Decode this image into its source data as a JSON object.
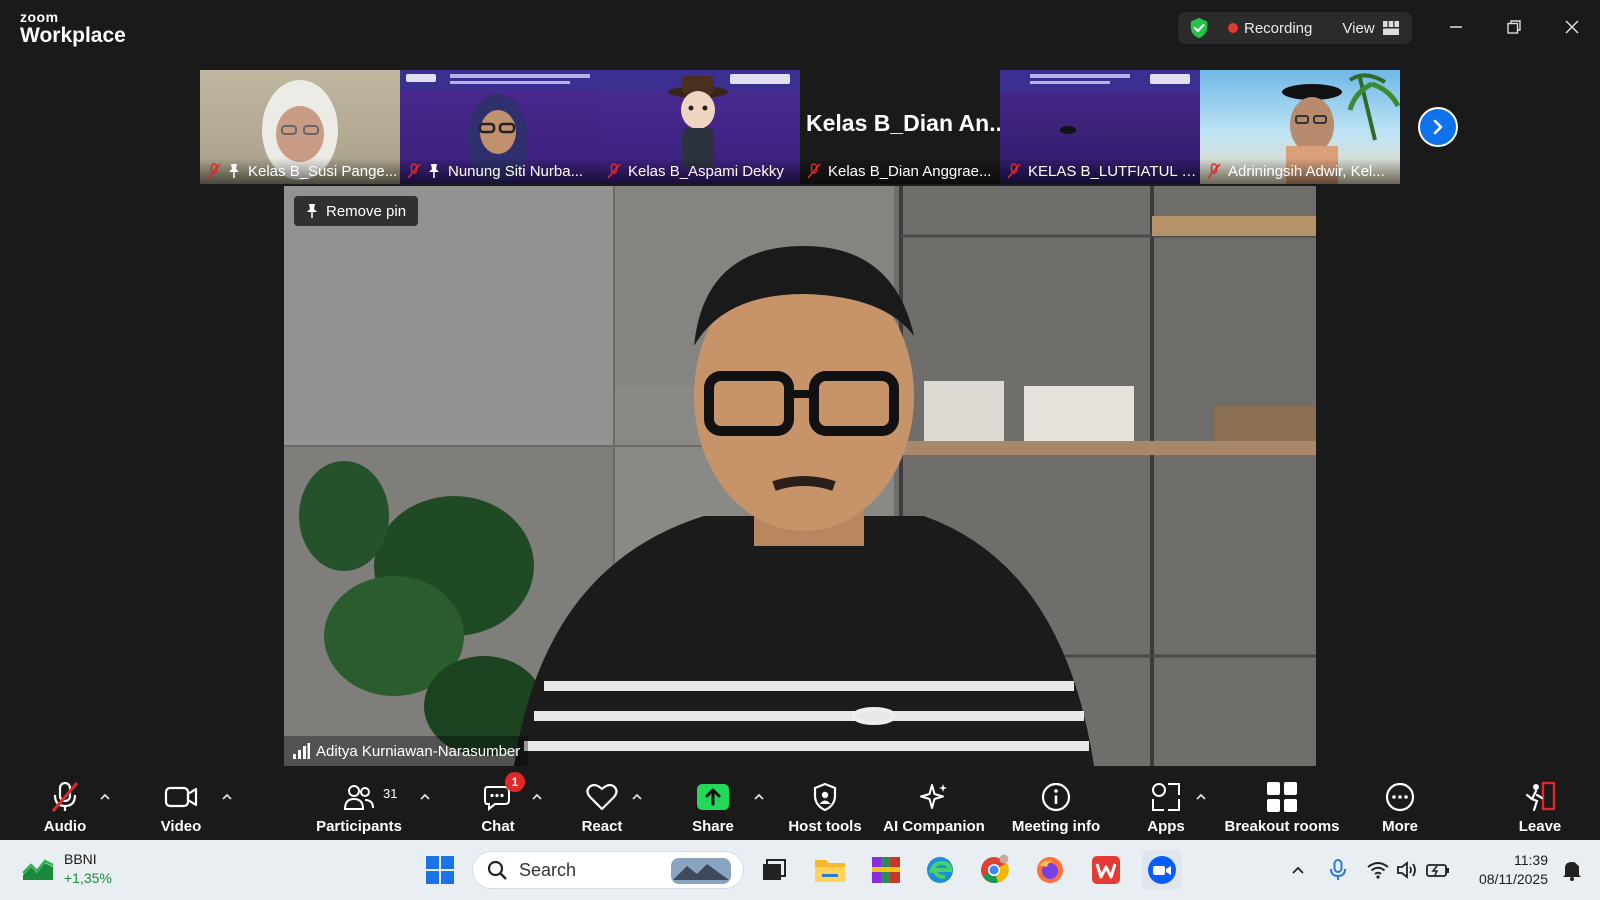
{
  "app": {
    "brand_top": "zoom",
    "brand_bottom": "Workplace"
  },
  "header": {
    "recording_label": "Recording",
    "view_label": "View"
  },
  "thumbnails": [
    {
      "name": "Kelas B_Susi Pange...",
      "pinned": true,
      "muted": true
    },
    {
      "name": "Nunung Siti Nurba...",
      "pinned": true,
      "muted": true
    },
    {
      "name": "Kelas B_Aspami Dekky",
      "pinned": false,
      "muted": true
    },
    {
      "name": "Kelas B_Dian Anggrae...",
      "big_text": "Kelas B_Dian An...",
      "pinned": false,
      "muted": true
    },
    {
      "name": "KELAS B_LUTFIATUL K...",
      "pinned": false,
      "muted": true
    },
    {
      "name": "Adriningsih Adwir, Kel...",
      "pinned": false,
      "muted": true
    }
  ],
  "main_video": {
    "remove_pin_label": "Remove pin",
    "speaker_name": "Aditya Kurniawan-Narasumber"
  },
  "toolbar": {
    "audio": "Audio",
    "video": "Video",
    "participants": "Participants",
    "participants_count": "31",
    "chat": "Chat",
    "chat_badge": "1",
    "react": "React",
    "share": "Share",
    "host_tools": "Host tools",
    "ai_companion": "AI Companion",
    "meeting_info": "Meeting info",
    "apps": "Apps",
    "breakout_rooms": "Breakout rooms",
    "more": "More",
    "leave": "Leave"
  },
  "taskbar": {
    "stock_name": "BBNI",
    "stock_change": "+1,35%",
    "search_placeholder": "Search",
    "time": "11:39",
    "date": "08/11/2025"
  },
  "colors": {
    "accent_blue": "#0e72ed",
    "share_green": "#23d959",
    "record_red": "#e53935",
    "shield_green": "#27c24c",
    "leave_red": "#e02828"
  }
}
